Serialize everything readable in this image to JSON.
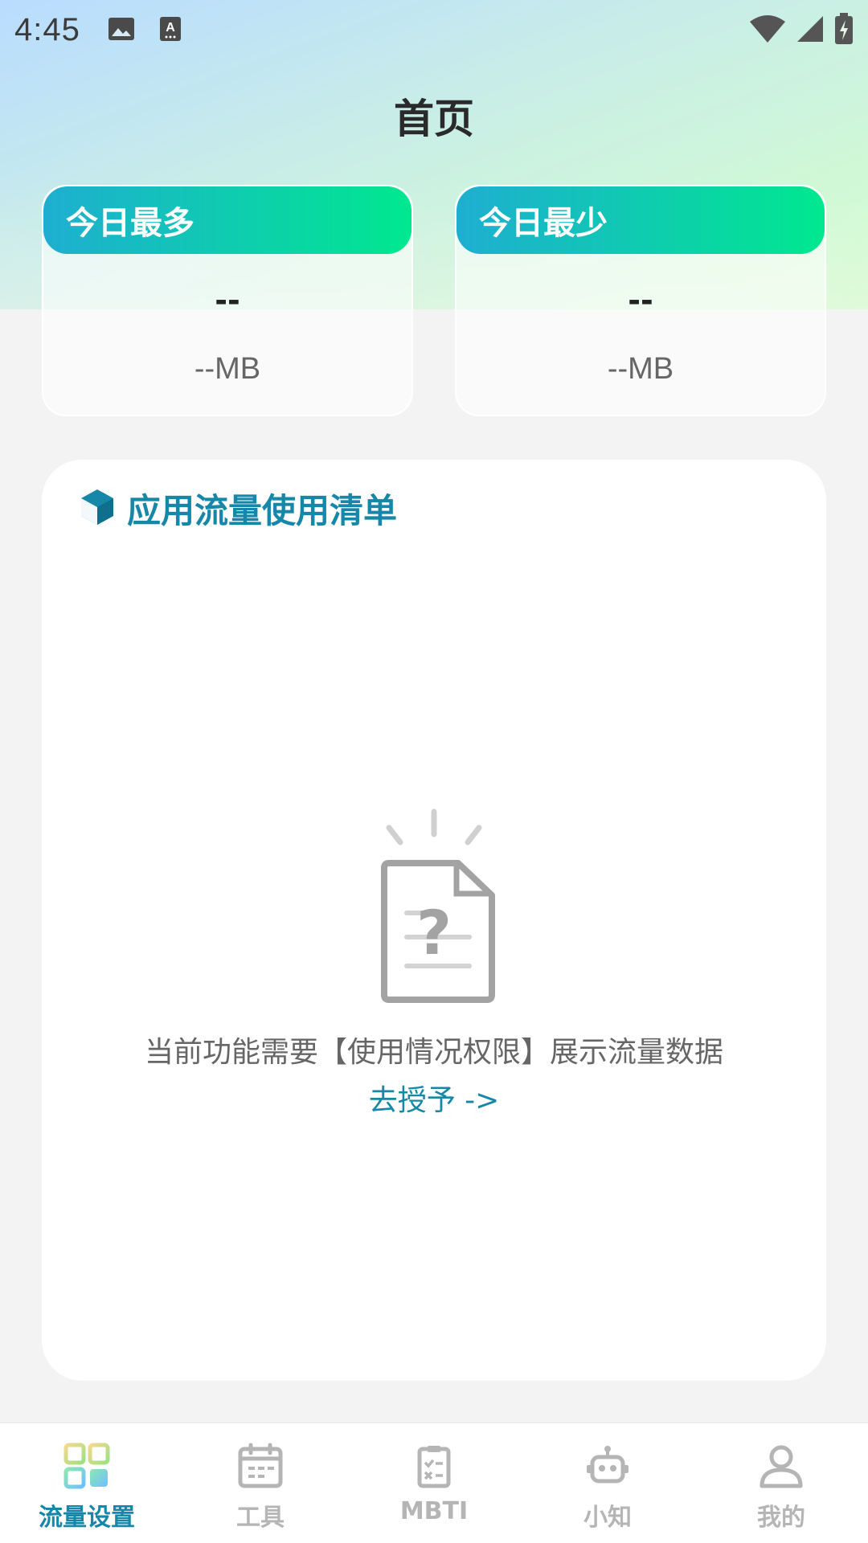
{
  "status_bar": {
    "time": "4:45",
    "icons": [
      "image-icon",
      "keyboard-a-icon",
      "wifi-icon",
      "signal-icon",
      "battery-charging-icon"
    ]
  },
  "header": {
    "title": "首页"
  },
  "stats": {
    "most": {
      "label": "今日最多",
      "app_name": "--",
      "value": "--MB"
    },
    "least": {
      "label": "今日最少",
      "app_name": "--",
      "value": "--MB"
    }
  },
  "app_list": {
    "title": "应用流量使用清单",
    "icon": "cube-icon",
    "empty_message": "当前功能需要【使用情况权限】展示流量数据",
    "grant_link": "去授予 ->"
  },
  "bottom_nav": {
    "items": [
      {
        "label": "流量设置",
        "icon": "grid-icon",
        "active": true
      },
      {
        "label": "工具",
        "icon": "calendar-icon",
        "active": false
      },
      {
        "label": "MBTI",
        "icon": "clipboard-icon",
        "active": false
      },
      {
        "label": "小知",
        "icon": "robot-icon",
        "active": false
      },
      {
        "label": "我的",
        "icon": "person-icon",
        "active": false
      }
    ]
  },
  "colors": {
    "accent": "#1687a8",
    "card_gradient_start": "#1eaed1",
    "card_gradient_end": "#00e88f",
    "inactive_nav": "#b5b5b5"
  }
}
